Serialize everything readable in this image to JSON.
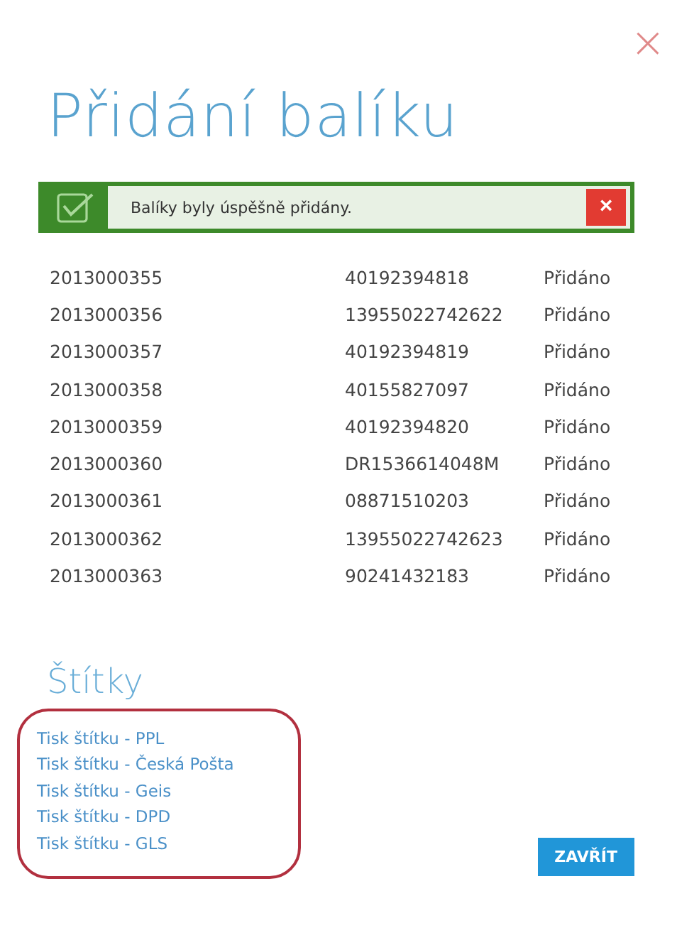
{
  "dialog": {
    "close_glyph": "×",
    "title": "Přidání balíku"
  },
  "alert": {
    "kind": "success",
    "message": "Balíky byly úspěšně přidány.",
    "dismiss_glyph": "×"
  },
  "rows": [
    {
      "id": "2013000355",
      "tracking": "40192394818",
      "status": "Přidáno"
    },
    {
      "id": "2013000356",
      "tracking": "13955022742622",
      "status": "Přidáno"
    },
    {
      "id": "2013000357",
      "tracking": "40192394819",
      "status": "Přidáno"
    },
    {
      "id": "2013000358",
      "tracking": "40155827097",
      "status": "Přidáno"
    },
    {
      "id": "2013000359",
      "tracking": "40192394820",
      "status": "Přidáno"
    },
    {
      "id": "2013000360",
      "tracking": "DR1536614048M",
      "status": "Přidáno"
    },
    {
      "id": "2013000361",
      "tracking": "08871510203",
      "status": "Přidáno"
    },
    {
      "id": "2013000362",
      "tracking": "13955022742623",
      "status": "Přidáno"
    },
    {
      "id": "2013000363",
      "tracking": "90241432183",
      "status": "Přidáno"
    }
  ],
  "labels": {
    "heading": "Štítky",
    "highlighted": true,
    "links": [
      "Tisk štítku - PPL",
      "Tisk štítku - Česká Pošta",
      "Tisk štítku - Geis",
      "Tisk štítku - DPD",
      "Tisk štítku - GLS"
    ]
  },
  "buttons": [
    "ZAVŘÍT"
  ]
}
